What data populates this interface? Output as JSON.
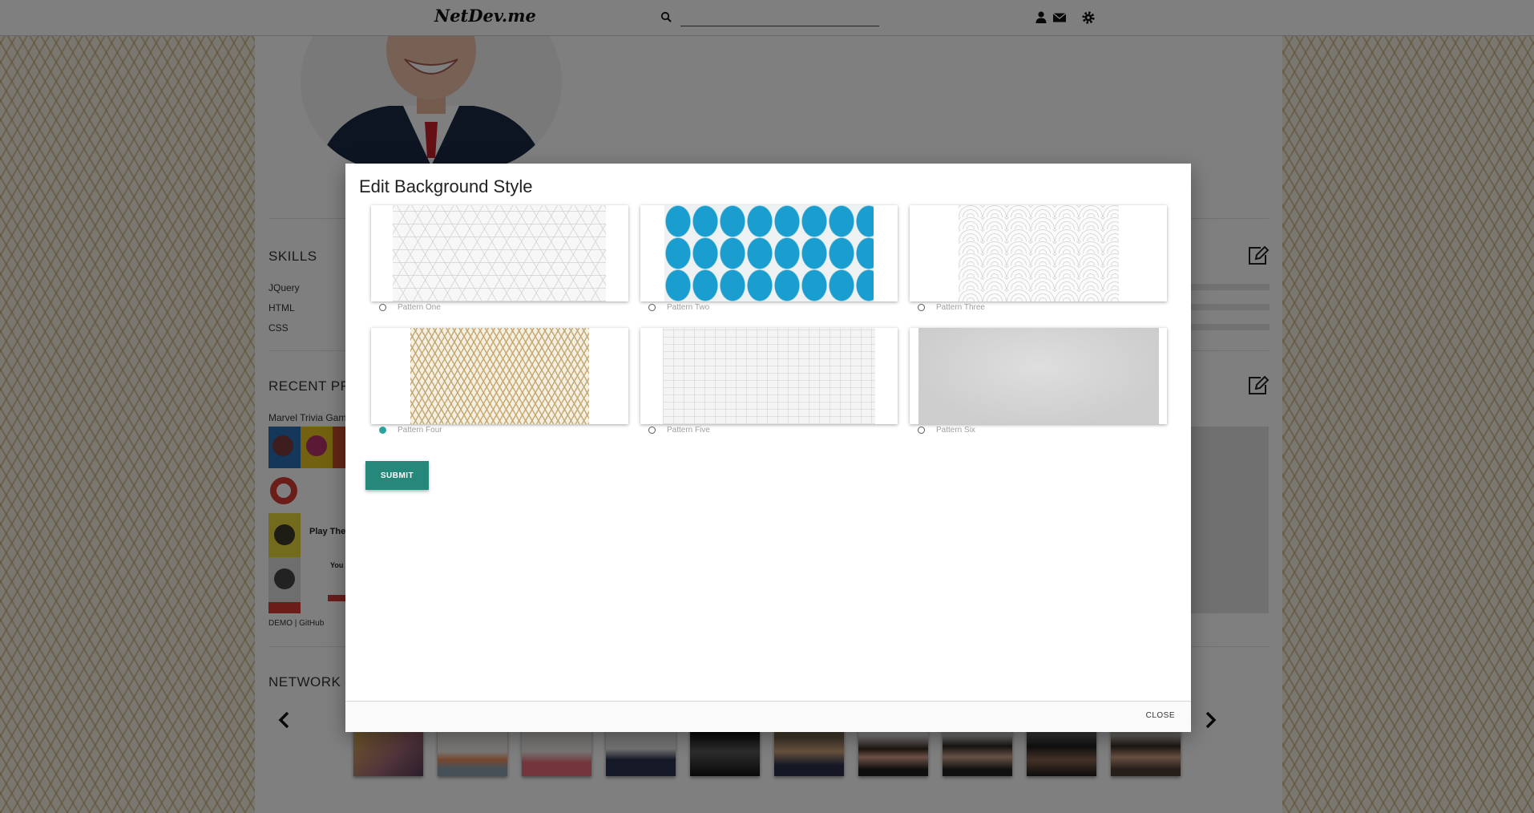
{
  "navbar": {
    "brand": "NetDev.me",
    "search_placeholder": "",
    "icons": [
      "search-icon",
      "user-icon",
      "envelope-icon",
      "gear-icon"
    ]
  },
  "profile": {
    "skills_title": "SKILLS",
    "skills": [
      "JQuery",
      "HTML",
      "CSS"
    ],
    "projects_title": "RECENT PR",
    "project_name": "Marvel Trivia Gam",
    "project_links": "DEMO | GitHub",
    "project_thumb_text_1": "Play The",
    "project_thumb_text_2": "You",
    "network_title": "NETWORK"
  },
  "modal": {
    "title": "Edit Background Style",
    "patterns": [
      {
        "label": "Pattern One",
        "selected": false
      },
      {
        "label": "Pattern Two",
        "selected": false
      },
      {
        "label": "Pattern Three",
        "selected": false
      },
      {
        "label": "Pattern Four",
        "selected": true
      },
      {
        "label": "Pattern Five",
        "selected": false
      },
      {
        "label": "Pattern Six",
        "selected": false
      }
    ],
    "submit_label": "SUBMIT",
    "close_label": "CLOSE"
  },
  "colors": {
    "accent": "#26a69a",
    "submit": "#26877b",
    "pattern_two_blue": "#1a9ed0",
    "pattern_four_gold": "#c3a469"
  }
}
